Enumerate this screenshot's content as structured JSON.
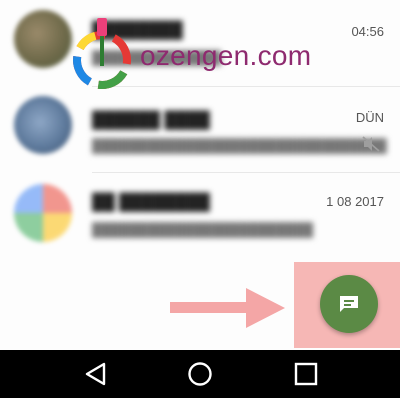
{
  "chats": [
    {
      "name": "",
      "preview": "",
      "time": "04:56",
      "muted": false
    },
    {
      "name": "",
      "preview": "",
      "time": "DÜN",
      "muted": true
    },
    {
      "name": "",
      "preview": "",
      "time": "1 08 2017",
      "muted": false
    }
  ],
  "watermark": {
    "text": "ozengen.com"
  },
  "fab": {
    "icon": "new-chat-icon"
  },
  "navbar": {
    "icons": [
      "back-icon",
      "home-icon",
      "recent-apps-icon"
    ]
  },
  "colors": {
    "fab": "#5b8a45",
    "highlight": "#f6b7b5",
    "arrow": "#f4a6a6",
    "navbar": "#000000",
    "watermark_text": "#8e2a6f"
  }
}
